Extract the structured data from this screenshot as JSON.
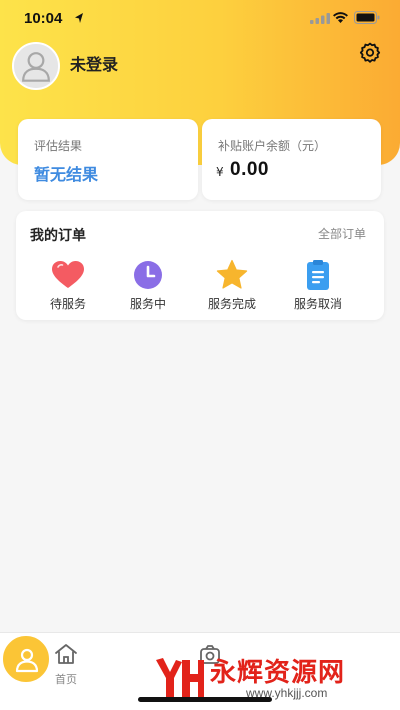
{
  "status": {
    "time": "10:04"
  },
  "profile": {
    "login_label": "未登录"
  },
  "cards": {
    "evaluation": {
      "title": "评估结果",
      "value": "暂无结果"
    },
    "balance": {
      "title": "补贴账户余额（元）",
      "currency": "¥",
      "value": "0.00"
    }
  },
  "orders": {
    "title": "我的订单",
    "all_label": "全部订单",
    "items": [
      {
        "label": "待服务",
        "icon": "heart-icon",
        "color": "#f45b62"
      },
      {
        "label": "服务中",
        "icon": "clock-icon",
        "color": "#8a6ee6"
      },
      {
        "label": "服务完成",
        "icon": "star-icon",
        "color": "#f7b52d"
      },
      {
        "label": "服务取消",
        "icon": "clipboard-icon",
        "color": "#3b9ef0"
      }
    ]
  },
  "tabbar": {
    "tabs": [
      {
        "label": "首页",
        "icon": "home-icon"
      },
      {
        "label": "",
        "icon": "camera-icon"
      },
      {
        "label": "",
        "icon": "user-icon"
      }
    ]
  },
  "watermark": {
    "text": "永辉资源网",
    "url": "www.yhkjjj.com"
  },
  "colors": {
    "accent": "#fdd03e",
    "accent_end": "#fbab33",
    "link_blue": "#3f8be0",
    "watermark_red": "#e2231a"
  }
}
